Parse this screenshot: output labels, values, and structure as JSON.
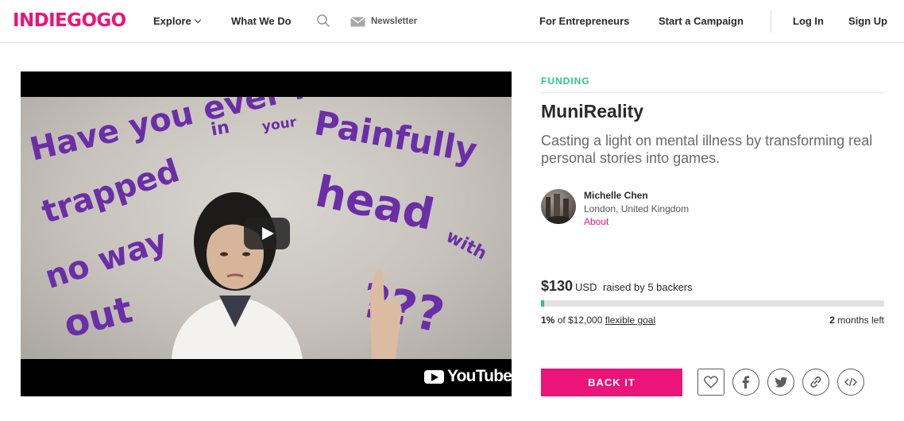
{
  "header": {
    "logo": "INDIEGOGO",
    "explore": "Explore",
    "what_we_do": "What We Do",
    "newsletter": "Newsletter",
    "for_entrepreneurs": "For Entrepreneurs",
    "start_campaign": "Start a Campaign",
    "log_in": "Log In",
    "sign_up": "Sign Up"
  },
  "video": {
    "overlay_text": [
      "Have you ever felt",
      "trapped",
      "in",
      "your",
      "Painfully",
      "head",
      "with",
      "no way",
      "out",
      "???"
    ],
    "provider": "YouTube"
  },
  "campaign": {
    "status": "FUNDING",
    "title": "MuniReality",
    "tagline": "Casting a light on mental illness by transforming real personal stories into games.",
    "owner": {
      "name": "Michelle Chen",
      "location": "London, United Kingdom",
      "about_link": "About"
    },
    "funding": {
      "amount": "$130",
      "currency": "USD",
      "backers_text": "raised by 5 backers",
      "percent": "1%",
      "goal_text": "of $12,000",
      "goal_type": "flexible goal",
      "progress_fraction": 0.01,
      "time_left_num": "2",
      "time_left_unit": "months left"
    },
    "back_button": "BACK IT"
  },
  "colors": {
    "brand": "#eb1478",
    "funding_green": "#2cc784",
    "text": "#2a2a2a"
  },
  "share_icons": [
    "heart-icon",
    "facebook-icon",
    "twitter-icon",
    "link-icon",
    "embed-icon"
  ]
}
